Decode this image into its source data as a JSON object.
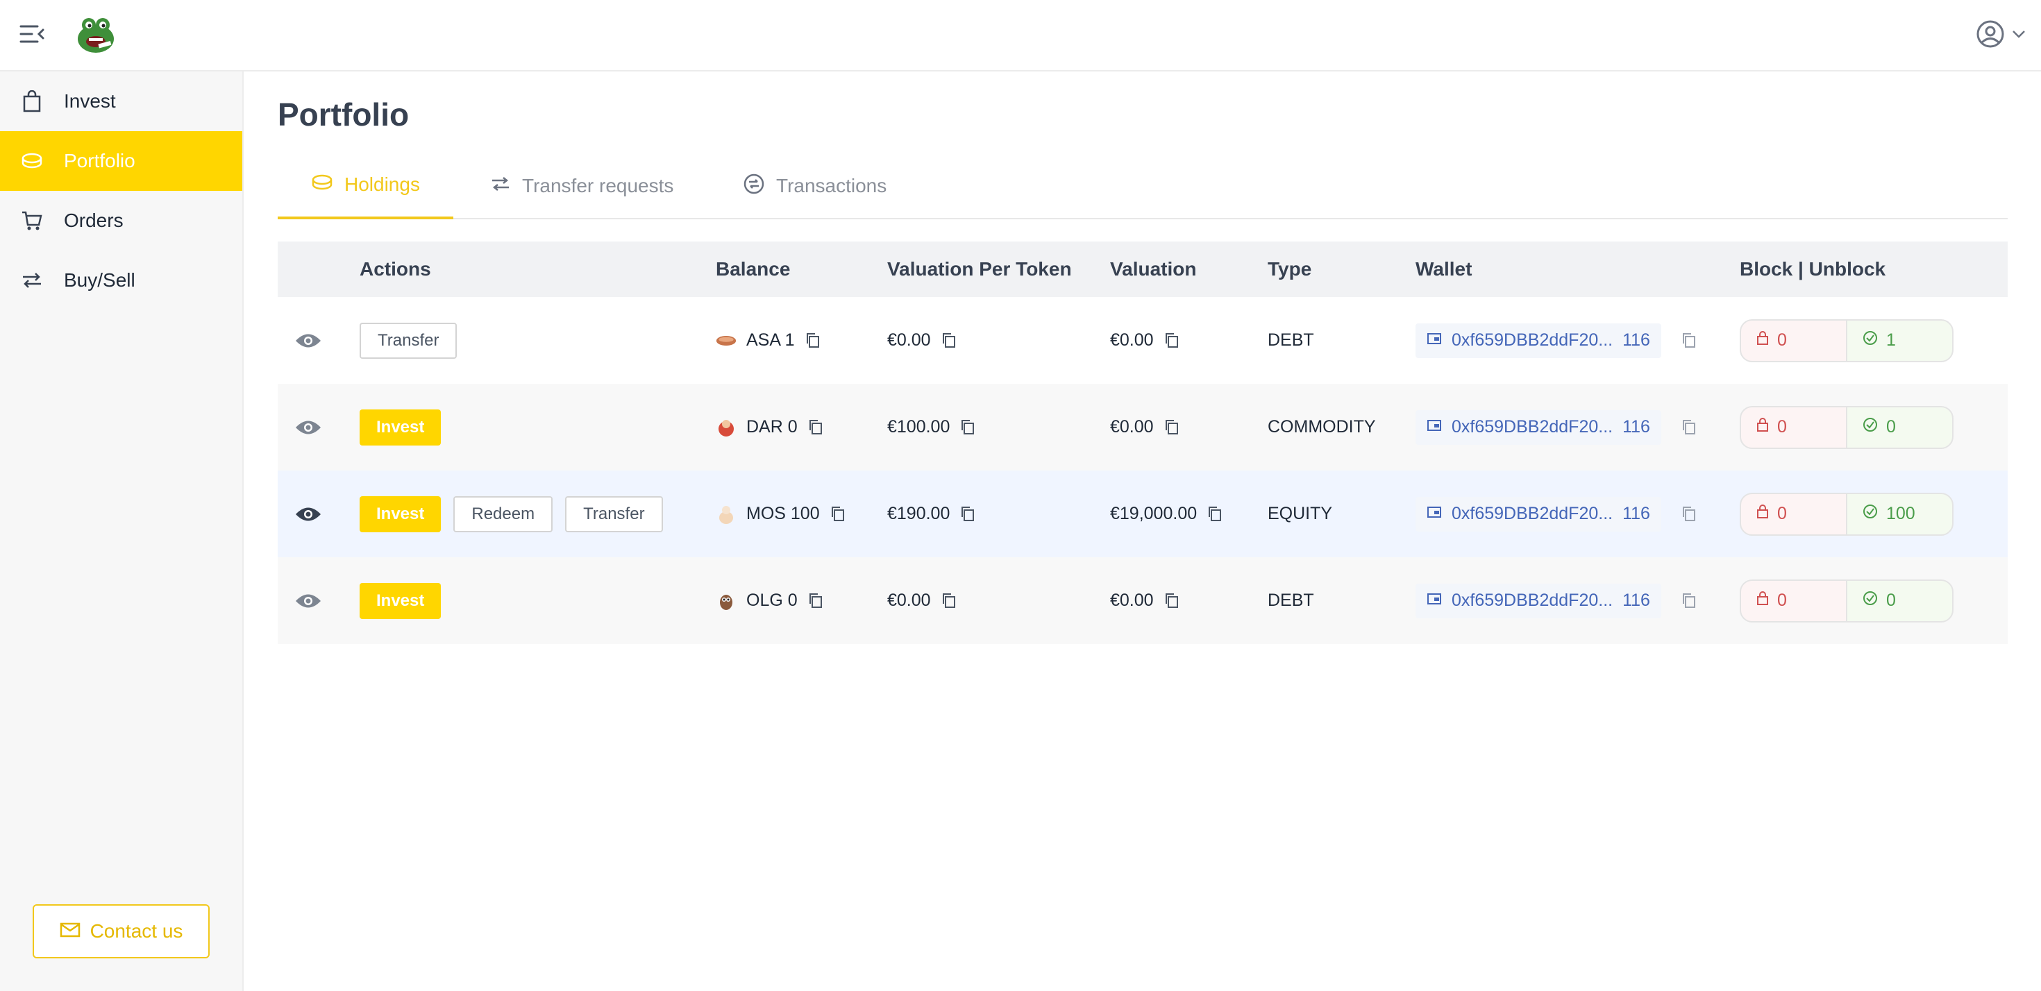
{
  "header": {
    "menu_icon": "menu-collapse-icon",
    "logo": "frog-logo",
    "account_icon": "user-circle-icon"
  },
  "sidebar": {
    "items": [
      {
        "label": "Invest",
        "icon": "shopping-bag-icon",
        "active": false
      },
      {
        "label": "Portfolio",
        "icon": "coins-icon",
        "active": true
      },
      {
        "label": "Orders",
        "icon": "cart-icon",
        "active": false
      },
      {
        "label": "Buy/Sell",
        "icon": "swap-icon",
        "active": false
      }
    ],
    "contact_label": "Contact us"
  },
  "page": {
    "title": "Portfolio"
  },
  "tabs": [
    {
      "label": "Holdings",
      "active": true
    },
    {
      "label": "Transfer requests",
      "active": false
    },
    {
      "label": "Transactions",
      "active": false
    }
  ],
  "table": {
    "columns": [
      "Actions",
      "Balance",
      "Valuation Per Token",
      "Valuation",
      "Type",
      "Wallet",
      "Block | Unblock"
    ],
    "rows": [
      {
        "actions": [
          "Transfer"
        ],
        "balance": "ASA 1",
        "vpt": "€0.00",
        "valuation": "€0.00",
        "type": "DEBT",
        "wallet": "0xf659DBB2ddF20...",
        "wallet_num": "116",
        "blocked": "0",
        "unblocked": "1"
      },
      {
        "actions": [
          "Invest"
        ],
        "balance": "DAR 0",
        "vpt": "€100.00",
        "valuation": "€0.00",
        "type": "COMMODITY",
        "wallet": "0xf659DBB2ddF20...",
        "wallet_num": "116",
        "blocked": "0",
        "unblocked": "0"
      },
      {
        "actions": [
          "Invest",
          "Redeem",
          "Transfer"
        ],
        "balance": "MOS 100",
        "vpt": "€190.00",
        "valuation": "€19,000.00",
        "type": "EQUITY",
        "wallet": "0xf659DBB2ddF20...",
        "wallet_num": "116",
        "blocked": "0",
        "unblocked": "100"
      },
      {
        "actions": [
          "Invest"
        ],
        "balance": "OLG 0",
        "vpt": "€0.00",
        "valuation": "€0.00",
        "type": "DEBT",
        "wallet": "0xf659DBB2ddF20...",
        "wallet_num": "116",
        "blocked": "0",
        "unblocked": "0"
      }
    ]
  },
  "colors": {
    "accent": "#ffd600",
    "link": "#4466b8",
    "lock": "#d05050",
    "unlock": "#4a9d4a"
  }
}
